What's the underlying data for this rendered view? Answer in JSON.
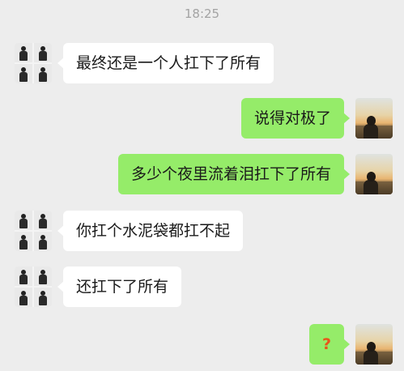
{
  "timestamp": "18:25",
  "messages": [
    {
      "text": "最终还是一个人扛下了所有"
    },
    {
      "text": "说得对极了"
    },
    {
      "text": "多少个夜里流着泪扛下了所有"
    },
    {
      "text": "你扛个水泥袋都扛不起"
    },
    {
      "text": "还扛下了所有"
    },
    {
      "text": "?"
    }
  ],
  "colors": {
    "background": "#ededed",
    "incoming_bubble": "#ffffff",
    "outgoing_bubble": "#95ec69",
    "question_mark": "#e8541a"
  },
  "icons": {
    "contact_avatar": "grid-portrait-avatar",
    "self_avatar": "sunset-silhouette-avatar"
  }
}
